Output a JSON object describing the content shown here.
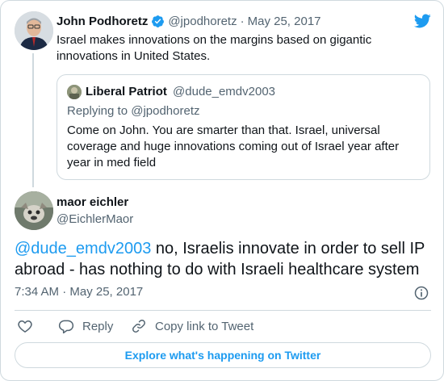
{
  "colors": {
    "accent": "#1d9bf0",
    "verified": "#1d9bf0",
    "secondary_text": "#536471",
    "border": "#cfd9de"
  },
  "parent": {
    "name": "John Podhoretz",
    "handle": "@jpodhoretz",
    "separator": "·",
    "date": "May 25, 2017",
    "text": "Israel makes innovations on the margins based on gigantic innovations in United States.",
    "icons": {
      "verified": "verified-badge-icon",
      "brand": "twitter-bird-icon"
    }
  },
  "quote": {
    "name": "Liberal Patriot",
    "handle": "@dude_emdv2003",
    "replying_to": "Replying to @jpodhoretz",
    "text": "Come on John. You are smarter than that. Israel, universal coverage and huge innovations coming out of Israel year after year in med field"
  },
  "tweet": {
    "name": "maor eichler",
    "handle": "@EichlerMaor",
    "mention": "@dude_emdv2003",
    "text": " no, Israelis innovate in order to sell IP abroad - has nothing to do with Israeli healthcare system",
    "timestamp": "7:34 AM · May 25, 2017"
  },
  "actions": {
    "like_icon": "heart-icon",
    "reply_label": "Reply",
    "copy_label": "Copy link to Tweet"
  },
  "footer": {
    "explore_label": "Explore what's happening on Twitter"
  }
}
